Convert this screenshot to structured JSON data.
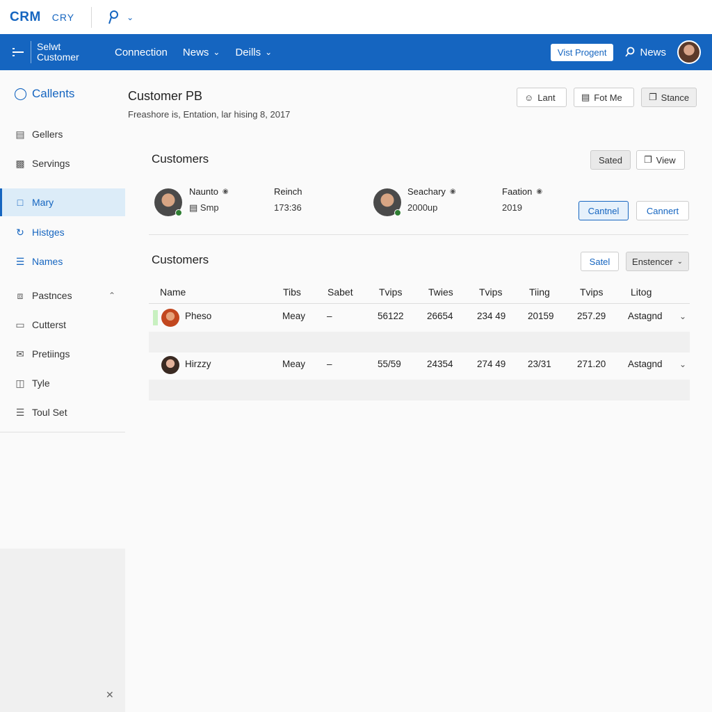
{
  "topbar": {
    "logo": "CRM",
    "logo_sub": "CRY",
    "app_icon": "pin-icon"
  },
  "navbar": {
    "brand_line1": "Selwt",
    "brand_line2": "Customer",
    "items": [
      {
        "label": "Connection",
        "has_chevron": false
      },
      {
        "label": "News",
        "has_chevron": true
      },
      {
        "label": "Deills",
        "has_chevron": true
      }
    ],
    "visit_button": "Vist Progent",
    "news_link": "News"
  },
  "sidebar": {
    "items": [
      {
        "label": "Callents",
        "icon": "shield-icon"
      },
      {
        "label": "Gellers",
        "icon": "book-icon"
      },
      {
        "label": "Servings",
        "icon": "chart-icon"
      },
      {
        "label": "Mary",
        "icon": "file-icon"
      },
      {
        "label": "Histges",
        "icon": "refresh-icon"
      },
      {
        "label": "Names",
        "icon": "list-icon"
      },
      {
        "label": "Pastnces",
        "icon": "link-icon"
      },
      {
        "label": "Cutterst",
        "icon": "monitor-icon"
      },
      {
        "label": "Pretiings",
        "icon": "mail-icon"
      },
      {
        "label": "Tyle",
        "icon": "document-icon"
      },
      {
        "label": "Toul Set",
        "icon": "menu-icon"
      }
    ]
  },
  "header": {
    "title": "Customer PB",
    "subtitle": "Freashore is, Entation, lar hising 8, 2017",
    "buttons": [
      {
        "label": "Lant",
        "icon": "user-icon"
      },
      {
        "label": "Fot Me",
        "icon": "table-icon"
      },
      {
        "label": "Stance",
        "icon": "copy-icon"
      }
    ]
  },
  "customers_section": {
    "title": "Customers",
    "sated_label": "Sated",
    "view_label": "View",
    "cards": [
      {
        "name_label": "Naunto",
        "value": "Smp"
      },
      {
        "name_label": "Reinch",
        "value": "173:36"
      },
      {
        "name_label": "Seachary",
        "value": "2000up"
      },
      {
        "name_label": "Faation",
        "value": "2019"
      }
    ],
    "cantnel_label": "Cantnel",
    "cannert_label": "Cannert"
  },
  "table_section": {
    "title": "Customers",
    "satel_label": "Satel",
    "filter_label": "Enstencer",
    "columns": [
      "Name",
      "Tibs",
      "Sabet",
      "Tvips",
      "Twies",
      "Tvips",
      "Tiing",
      "Tvips",
      "Litog"
    ],
    "rows": [
      {
        "name": "Pheso",
        "tibs": "Meay",
        "sabet": "–",
        "tvips1": "56122",
        "twies": "26654",
        "tvips2": "234 49",
        "tiing": "20159",
        "tvips3": "257.29",
        "litog": "Astagnd"
      },
      {
        "name": "Hirzzy",
        "tibs": "Meay",
        "sabet": "–",
        "tvips1": "55/59",
        "twies": "24354",
        "tvips2": "274 49",
        "tiing": "23/31",
        "tvips3": "271.20",
        "litog": "Astagnd"
      }
    ]
  },
  "colors": {
    "brand": "#1565c0",
    "active_bg": "#dcecf8"
  }
}
